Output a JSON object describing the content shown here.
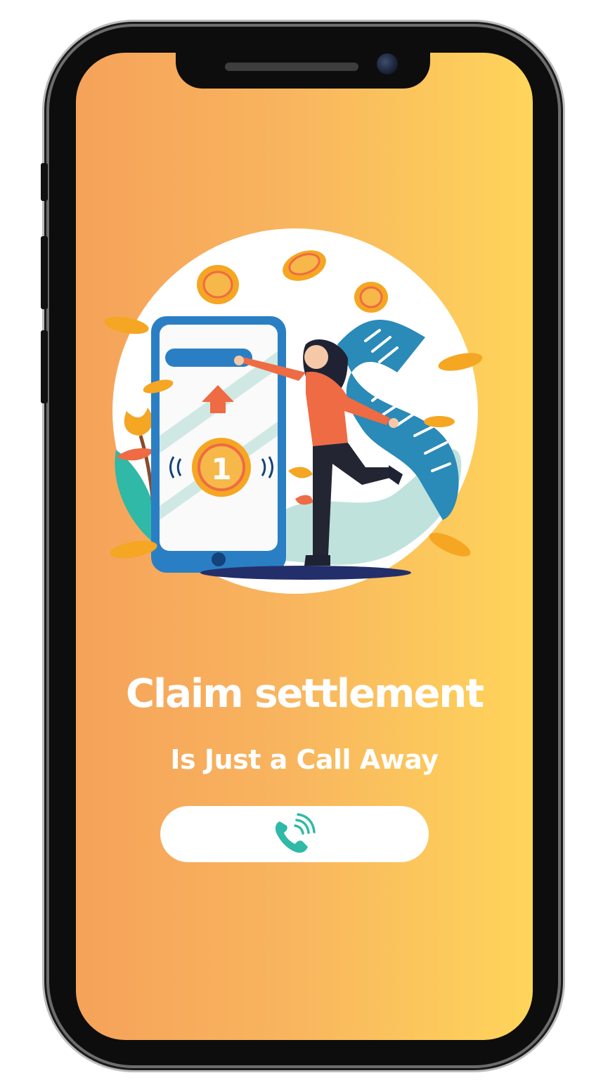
{
  "screen": {
    "headline": "Claim settlement",
    "subheadline": "Is Just a Call Away",
    "call_button": {
      "icon": "phone-call-icon"
    },
    "illustration": {
      "coin_label": "1",
      "icons": [
        "coin-icon",
        "up-arrow-icon",
        "receipt-icon",
        "leaf-icon"
      ]
    }
  },
  "colors": {
    "background_start": "#f6a25a",
    "background_end": "#ffd55a",
    "accent_blue": "#2a7fc4",
    "accent_teal": "#2fb9a6",
    "coin": "#f5a623",
    "figure_shirt": "#ee6b44"
  }
}
